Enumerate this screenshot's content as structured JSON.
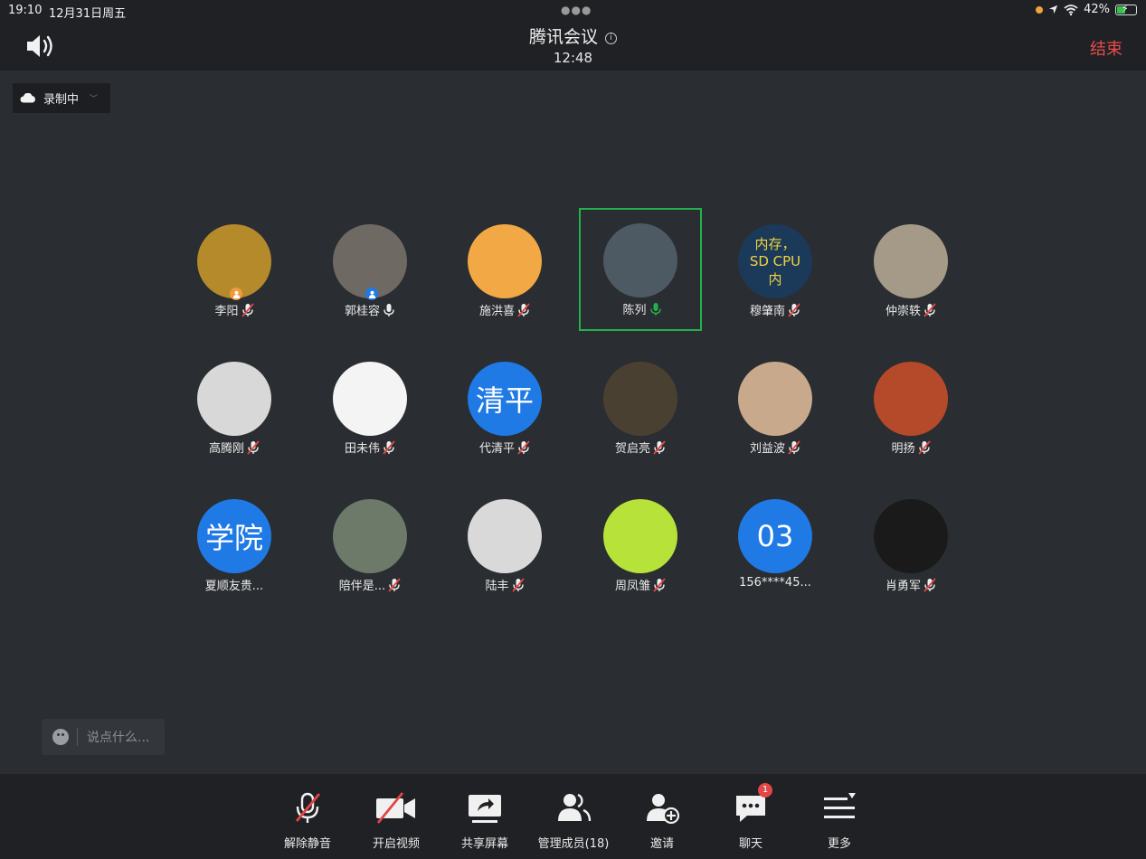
{
  "status_bar": {
    "time": "19:10",
    "date": "12月31日周五",
    "battery": "42%"
  },
  "header": {
    "title": "腾讯会议",
    "duration": "12:48",
    "end_label": "结束"
  },
  "recording": {
    "label": "录制中"
  },
  "participants": [
    {
      "name": "李阳",
      "mic": "muted",
      "avatar_color": "#b48a2a",
      "badge": "host"
    },
    {
      "name": "郭桂容",
      "mic": "on",
      "avatar_color": "#6e6a63",
      "badge": "cohost"
    },
    {
      "name": "施洪喜",
      "mic": "muted",
      "avatar_color": "#f2a844"
    },
    {
      "name": "陈列",
      "mic": "speaking",
      "avatar_color": "#4d5a63",
      "active": true
    },
    {
      "name": "穆肇南",
      "mic": "muted",
      "avatar_color": "#1b3a5a",
      "avatar_text": "内存，SD CPU 内"
    },
    {
      "name": "仲崇轶",
      "mic": "muted",
      "avatar_color": "#a59a88"
    },
    {
      "name": "高腾刚",
      "mic": "muted",
      "avatar_color": "#d8d8d8"
    },
    {
      "name": "田未伟",
      "mic": "muted",
      "avatar_color": "#f4f4f4"
    },
    {
      "name": "代清平",
      "mic": "muted",
      "avatar_color": "#1f7ae6",
      "avatar_text": "清平"
    },
    {
      "name": "贺启亮",
      "mic": "muted",
      "avatar_color": "#4a4032"
    },
    {
      "name": "刘益波",
      "mic": "muted",
      "avatar_color": "#c9a98c"
    },
    {
      "name": "明扬",
      "mic": "muted",
      "avatar_color": "#b44a2a"
    },
    {
      "name": "夏顺友贵...",
      "mic": "none",
      "avatar_color": "#1f7ae6",
      "avatar_text": "学院"
    },
    {
      "name": "陪伴是...",
      "mic": "muted",
      "avatar_color": "#6d7a6a"
    },
    {
      "name": "陆丰",
      "mic": "muted",
      "avatar_color": "#d9d9d9"
    },
    {
      "name": "周凤雏",
      "mic": "muted",
      "avatar_color": "#b6e23a"
    },
    {
      "name": "156****45...",
      "mic": "none",
      "avatar_color": "#1f7ae6",
      "avatar_text": "03"
    },
    {
      "name": "肖勇军",
      "mic": "muted",
      "avatar_color": "#1a1a1a"
    }
  ],
  "chat_input": {
    "placeholder": "说点什么..."
  },
  "toolbar": {
    "unmute": "解除静音",
    "start_video": "开启视频",
    "share_screen": "共享屏幕",
    "manage_members": "管理成员(18)",
    "invite": "邀请",
    "chat": "聊天",
    "chat_badge": "1",
    "more": "更多"
  },
  "colors": {
    "accent_end": "#e94b4b",
    "speaking_green": "#22b14c",
    "muted_red": "#e24646"
  }
}
